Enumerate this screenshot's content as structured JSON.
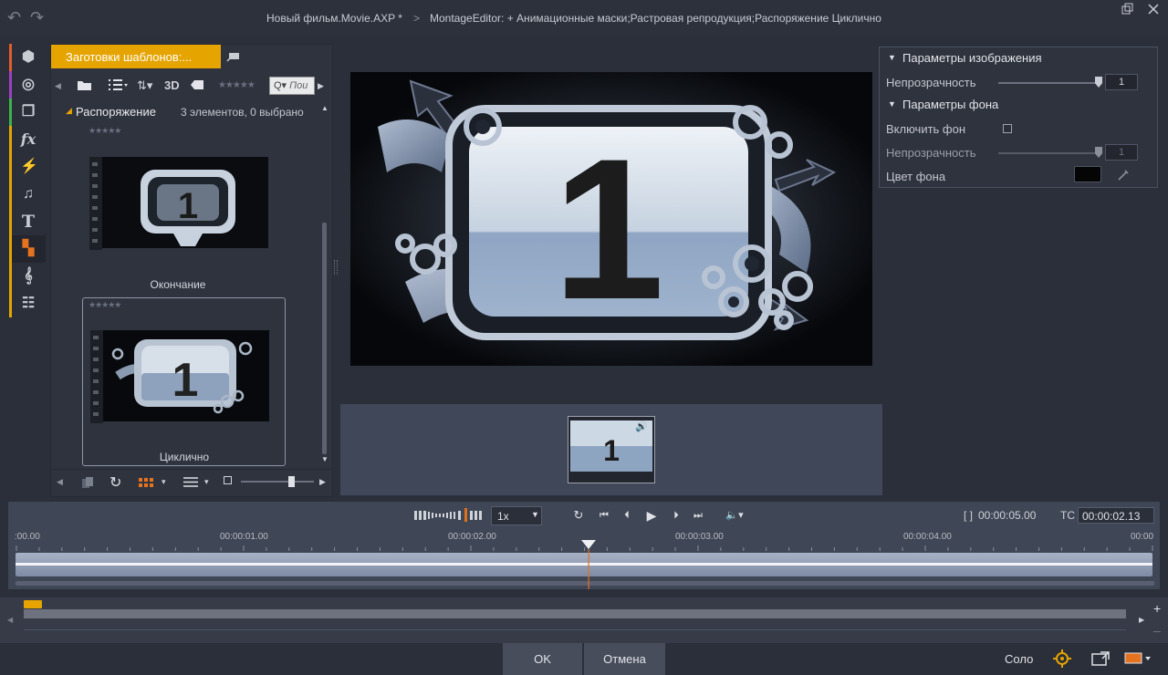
{
  "titlebar": {
    "project": "Новый фильм.Movie.AXP *",
    "separator": ">",
    "editor": "MontageEditor: + Анимационные маски;Растровая репродукция;Распоряжение  Циклично"
  },
  "library": {
    "tab_label": "Заготовки шаблонов:...",
    "toolbar_3d": "3D",
    "search_placeholder": "Пои",
    "folder_name": "Распоряжение",
    "folder_status": "3 элементов, 0 выбрано",
    "items": [
      {
        "label": "Окончание"
      },
      {
        "label": "Циклично"
      }
    ]
  },
  "preview": {
    "big_number": "1"
  },
  "filmstrip": {
    "clip_number": "1"
  },
  "properties": {
    "section_image": "Параметры изображения",
    "opacity_label": "Непрозрачность",
    "opacity_value": "1",
    "section_bg": "Параметры фона",
    "enable_bg_label": "Включить фон",
    "bg_opacity_label": "Непрозрачность",
    "bg_opacity_value": "1",
    "bg_color_label": "Цвет фона",
    "bg_color": "#050505"
  },
  "transport": {
    "speed": "1x",
    "duration_prefix": "[ ]",
    "duration": "00:00:05.00",
    "tc_label": "TC",
    "timecode": "00:00:02.13"
  },
  "ruler": {
    "labels": [
      ":00.00",
      "00:00:01.00",
      "00:00:02.00",
      "00:00:03.00",
      "00:00:04.00",
      "00:00"
    ]
  },
  "footer": {
    "ok": "OK",
    "cancel": "Отмена",
    "solo": "Соло"
  },
  "colors": {
    "accent": "#e5a400",
    "playhead": "#e07020"
  }
}
